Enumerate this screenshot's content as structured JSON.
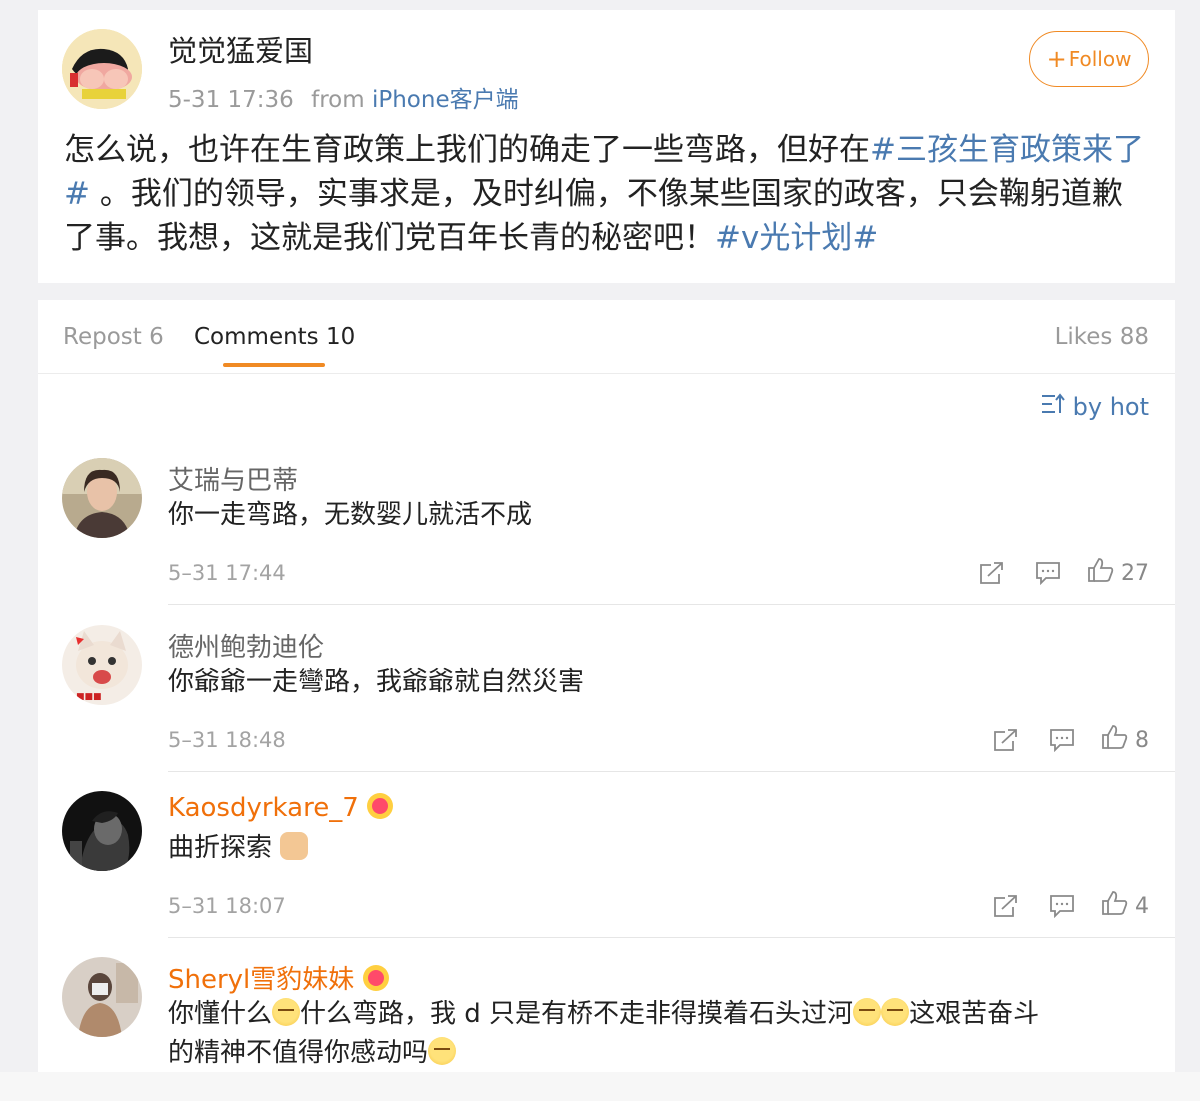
{
  "post": {
    "author": "觉觉猛爱国",
    "time": "5-31 17:36",
    "from_prefix": "from",
    "source": "iPhone客户端",
    "follow_label": "Follow",
    "text_part1": "怎么说，也许在生育政策上我们的确走了一些弯路，但好在",
    "hashtag1": "#三孩生育政策来了#",
    "text_part2": " 。我们的领导，实事求是，及时纠偏，不像某些国家的政客，只会鞠躬道歉了事。我想，这就是我们党百年长青的秘密吧！",
    "hashtag2": "#v光计划#"
  },
  "tabs": {
    "repost": "Repost 6",
    "comments": "Comments 10",
    "likes": "Likes 88"
  },
  "sort_label": "by hot",
  "comments": [
    {
      "name": "艾瑞与巴蒂",
      "text": "你一走弯路，无数婴儿就活不成",
      "time": "5–31 17:44",
      "likes": "27"
    },
    {
      "name": "德州鲍勃迪伦",
      "text": "你爺爺一走彎路，我爺爺就自然災害",
      "time": "5–31 18:48",
      "likes": "8"
    },
    {
      "name": "Kaosdyrkare_7",
      "text": "曲折探索",
      "time": "5–31 18:07",
      "likes": "4"
    },
    {
      "name": "Sheryl雪豹妹妹",
      "text_a": "你懂什么",
      "text_b": "什么弯路，我 d 只是有桥不走非得摸着石头过河",
      "text_c": "这艰苦奋斗",
      "text_d": "的精神不值得你感动吗"
    }
  ],
  "colors": {
    "link": "#4a7ab0",
    "accent": "#f08a24",
    "vip_name": "#f0700a"
  },
  "icons": [
    "share-icon",
    "comment-icon",
    "like-icon",
    "sort-icon",
    "plus-icon"
  ]
}
